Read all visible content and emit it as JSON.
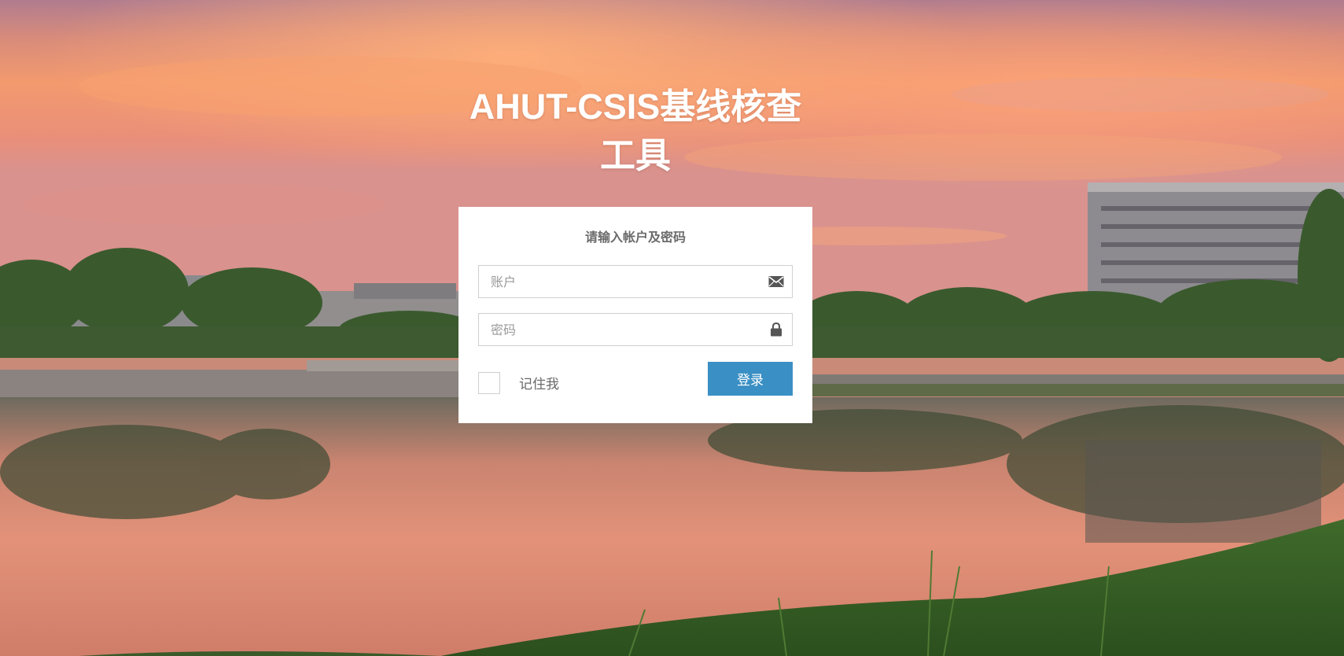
{
  "page": {
    "title": "AHUT-CSIS基线核查工具"
  },
  "login_form": {
    "heading": "请输入帐户及密码",
    "account": {
      "placeholder": "账户",
      "value": "",
      "icon": "envelope-icon"
    },
    "password": {
      "placeholder": "密码",
      "value": "",
      "icon": "lock-icon"
    },
    "remember_label": "记住我",
    "remember_checked": false,
    "submit_label": "登录"
  },
  "colors": {
    "primary_button": "#3a8fc4",
    "panel_background": "#ffffff",
    "title_text": "#ffffff"
  }
}
